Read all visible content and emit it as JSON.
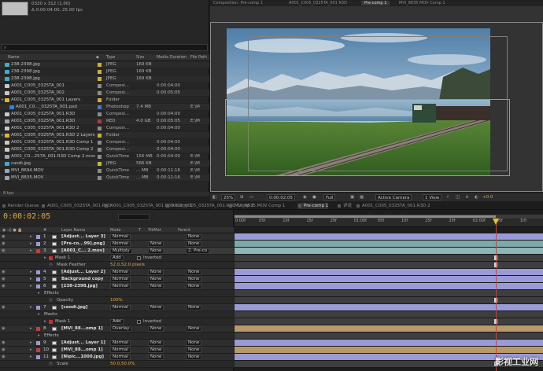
{
  "project": {
    "info_lines": [
      "0320 x 312 (1.00)",
      "Δ 0:00:04:00, 25.00 fps"
    ],
    "search_placeholder": "",
    "columns": [
      "Name",
      "Type",
      "Size",
      "Media Duration",
      "File Path"
    ],
    "items": [
      {
        "indent": 0,
        "twirl": "",
        "icon": "image",
        "name": "238-2398.jpg",
        "label": "#c9b23a",
        "type": "JPEG",
        "size": "169 KB",
        "duration": "",
        "path": ""
      },
      {
        "indent": 0,
        "twirl": "",
        "icon": "image",
        "name": "238-2398.jpg",
        "label": "#c9b23a",
        "type": "JPEG",
        "size": "169 KB",
        "duration": "",
        "path": ""
      },
      {
        "indent": 0,
        "twirl": "",
        "icon": "image",
        "name": "238-2398.jpg",
        "label": "#c9b23a",
        "type": "JPEG",
        "size": "169 KB",
        "duration": "",
        "path": ""
      },
      {
        "indent": 0,
        "twirl": "",
        "icon": "comp",
        "name": "A001_C005_0325TA_001",
        "label": "#8c8c8c",
        "type": "Composi...",
        "size": "",
        "duration": "0:00:04:00",
        "path": ""
      },
      {
        "indent": 0,
        "twirl": "",
        "icon": "comp",
        "name": "A001_C005_0325TA_002",
        "label": "#8c8c8c",
        "type": "Composi...",
        "size": "",
        "duration": "0:00:05:05",
        "path": ""
      },
      {
        "indent": 0,
        "twirl": "▸",
        "icon": "folder",
        "name": "A001_C005_0325TA_001 Layers",
        "label": "#c9b23a",
        "type": "Folder",
        "size": "",
        "duration": "",
        "path": ""
      },
      {
        "indent": 1,
        "twirl": "",
        "icon": "psd",
        "name": "A001_C0..._0325TA_001.psd",
        "label": "#4a79b8",
        "type": "Photoshop",
        "size": "7.4 MB",
        "duration": "",
        "path": "E:\\M"
      },
      {
        "indent": 0,
        "twirl": "",
        "icon": "comp",
        "name": "A001_C005_0325TA_001.R3D",
        "label": "#8c8c8c",
        "type": "Composi...",
        "size": "",
        "duration": "0:00:04:00",
        "path": ""
      },
      {
        "indent": 0,
        "twirl": "",
        "icon": "film",
        "name": "A001_C005_0325TA_001.R3D",
        "label": "#b03a3a",
        "type": "RED",
        "size": "4.0 GB",
        "duration": "0:00:05:05",
        "path": "E:\\M"
      },
      {
        "indent": 0,
        "twirl": "",
        "icon": "comp",
        "name": "A001_C005_0325TA_001.R3D 2",
        "label": "#8c8c8c",
        "type": "Composi...",
        "size": "",
        "duration": "0:00:04:00",
        "path": ""
      },
      {
        "indent": 0,
        "twirl": "▸",
        "icon": "folder",
        "name": "A001_C005_0325TA_001.R3D 2 Layers",
        "label": "#c9b23a",
        "type": "Folder",
        "size": "",
        "duration": "",
        "path": ""
      },
      {
        "indent": 0,
        "twirl": "",
        "icon": "comp",
        "name": "A001_C005_0325TA_001.R3D Comp 1",
        "label": "#8c8c8c",
        "type": "Composi...",
        "size": "",
        "duration": "0:00:04:00",
        "path": ""
      },
      {
        "indent": 0,
        "twirl": "",
        "icon": "comp",
        "name": "A001_C005_0325TA_001.R3D Comp 2",
        "label": "#8c8c8c",
        "type": "Composi...",
        "size": "",
        "duration": "0:00:04:00",
        "path": ""
      },
      {
        "indent": 0,
        "twirl": "",
        "icon": "film",
        "name": "A001_C0...257A_001.R3D Comp 2.mov",
        "label": "#8c8c8c",
        "type": "QuickTime",
        "size": "156 MB",
        "duration": "0:00:04:00",
        "path": "E:\\M"
      },
      {
        "indent": 0,
        "twirl": "",
        "icon": "image",
        "name": "caodi.jpg",
        "label": "#c9b23a",
        "type": "JPEG",
        "size": "566 KB",
        "duration": "",
        "path": "E:\\M"
      },
      {
        "indent": 0,
        "twirl": "",
        "icon": "film",
        "name": "MVI_8694.MOV",
        "label": "#8c8c8c",
        "type": "QuickTime",
        "size": "... MB",
        "duration": "0:00:11:16",
        "path": "E:\\M"
      },
      {
        "indent": 0,
        "twirl": "",
        "icon": "film",
        "name": "MVI_8835.MOV",
        "label": "#8c8c8c",
        "type": "QuickTime",
        "size": "... MB",
        "duration": "0:00:11:16",
        "path": "E:\\M"
      }
    ],
    "footer": "8 bpc"
  },
  "viewer": {
    "tabs": [
      "Composition: Pre-comp 1",
      "A001_C005_0325TA_001 R3D",
      "Pre-comp 1",
      "MVI_8835.MOV Comp 1"
    ],
    "active_tab": 2,
    "bar": {
      "zoom": "25%",
      "timecode": "0:00:02:05",
      "resolution": "Full",
      "camera": "Active Camera",
      "views": "1 View",
      "exposure": "+0.0"
    }
  },
  "timeline": {
    "tabs": [
      "Render Queue",
      "A001_C005_0325TA_001.R3D",
      "A001_C005_0325TA_001.R3D Comp 1",
      "A001_C005_0325TA_001.R3D Comp 2",
      "MVI_8835.MOV Comp 1",
      "Pre-comp 1",
      "详说",
      "A001_C005_0325TA_001.R3D 2"
    ],
    "active_tab": 5,
    "timecode": "0:00:02:05",
    "columns": [
      "Layer Name",
      "Mode",
      "T",
      "TrkMat",
      "Parent"
    ],
    "ruler_ticks": [
      "0:00f",
      "05f",
      "10f",
      "15f",
      "20f",
      "01:00f",
      "05f",
      "10f",
      "15f",
      "20f",
      "02:00f",
      "05f",
      "10f"
    ],
    "ruler_values": [
      0,
      5,
      10,
      15,
      20,
      25,
      30,
      35,
      40,
      45,
      50,
      55,
      60
    ],
    "current_frame": 55,
    "work_area_end_frame": 55,
    "rows": [
      {
        "kind": "layer",
        "num": "1",
        "name": "[Adjust... Layer 3]",
        "label": "#9a9ad6",
        "mode": "Normal",
        "trkmat": "",
        "parent": "None",
        "bar": "#9a9ad6"
      },
      {
        "kind": "layer",
        "num": "2",
        "name": "[Pre-co...99].png]",
        "label": "#9a9ad6",
        "mode": "Normal",
        "trkmat": "None",
        "parent": "None",
        "bar": "#7fa9a9"
      },
      {
        "kind": "layer",
        "num": "3",
        "name": "[A001_C... 2.mov]",
        "label": "#c04040",
        "mode": "Multiply",
        "trkmat": "None",
        "parent": "2. Pre-co",
        "bar": "#8fb6b6",
        "selected": true
      },
      {
        "kind": "mask",
        "name": "Mask 1",
        "mode": "Add",
        "inverted": "Inverted",
        "bar": "#595959"
      },
      {
        "kind": "prop",
        "name": "Mask Feather",
        "value": "52.0,52.0 pixels",
        "bar": "#595959"
      },
      {
        "kind": "layer",
        "num": "4",
        "name": "[Adjust... Layer 2]",
        "label": "#9a9ad6",
        "mode": "Normal",
        "trkmat": "None",
        "parent": "None",
        "bar": "#9a9ad6"
      },
      {
        "kind": "layer",
        "num": "5",
        "name": "Background copy",
        "label": "#9a9ad6",
        "mode": "Normal",
        "trkmat": "None",
        "parent": "None",
        "bar": "#9a9ad6"
      },
      {
        "kind": "layer",
        "num": "6",
        "name": "[238-2398.jpg]",
        "label": "#9a9ad6",
        "mode": "Normal",
        "trkmat": "None",
        "parent": "None",
        "bar": "#9a9ad6"
      },
      {
        "kind": "group",
        "name": "Effects",
        "bar": "#595959"
      },
      {
        "kind": "prop",
        "name": "Opacity",
        "value": "100%",
        "bar": "#595959"
      },
      {
        "kind": "layer",
        "num": "7",
        "name": "[caodi.jpg]",
        "label": "#9a9ad6",
        "mode": "Normal",
        "trkmat": "None",
        "parent": "None",
        "bar": "#9a9ad6"
      },
      {
        "kind": "group",
        "name": "Masks",
        "bar": "#595959"
      },
      {
        "kind": "mask",
        "name": "Mask 1",
        "mode": "Add",
        "inverted": "Inverted",
        "bar": "#595959"
      },
      {
        "kind": "layer",
        "num": "8",
        "name": "[MVI_88...omp 1]",
        "label": "#c04040",
        "mode": "Overlay",
        "trkmat": "None",
        "parent": "None",
        "bar": "#b89a6a"
      },
      {
        "kind": "group",
        "name": "Effects",
        "bar": "#595959"
      },
      {
        "kind": "layer",
        "num": "9",
        "name": "[Adjust... Layer 1]",
        "label": "#9a9ad6",
        "mode": "Normal",
        "trkmat": "None",
        "parent": "None",
        "bar": "#9a9ad6"
      },
      {
        "kind": "layer",
        "num": "10",
        "name": "[MVI_88...omp 1]",
        "label": "#c04040",
        "mode": "Normal",
        "trkmat": "None",
        "parent": "None",
        "bar": "#b89a6a"
      },
      {
        "kind": "layer",
        "num": "11",
        "name": "[Nipic...1000.jpg]",
        "label": "#9a9ad6",
        "mode": "Normal",
        "trkmat": "None",
        "parent": "None",
        "bar": "#9a9ad6"
      },
      {
        "kind": "prop",
        "name": "Scale",
        "value": "50.0,50.0%",
        "bar": "#595959"
      }
    ]
  },
  "watermark": "影视工业网",
  "colors": {
    "accent": "#f0a52c",
    "cti": "#d93c2c",
    "cti_head": "#f0c020"
  }
}
